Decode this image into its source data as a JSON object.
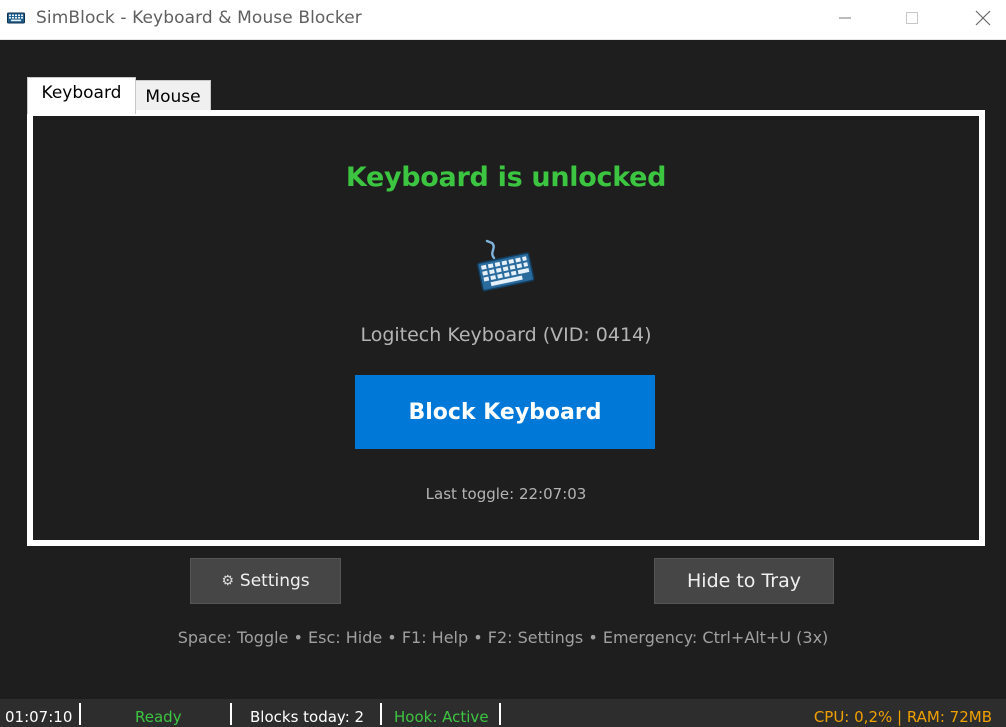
{
  "window": {
    "title": "SimBlock - Keyboard & Mouse Blocker",
    "icons": {
      "app": "keyboard-icon",
      "minimize": "minimize-icon",
      "maximize": "maximize-icon",
      "close": "close-icon"
    }
  },
  "tabs": [
    {
      "label": "Keyboard",
      "active": true
    },
    {
      "label": "Mouse",
      "active": false
    }
  ],
  "panel": {
    "status_text": "Keyboard is unlocked",
    "status_color": "#3cc540",
    "device_icon": "keyboard-icon",
    "device_label": "Logitech Keyboard (VID: 0414)",
    "action_button": "Block Keyboard",
    "action_color": "#0078d7",
    "last_toggle": "Last toggle: 22:07:03"
  },
  "buttons": {
    "settings_icon": "⚙",
    "settings_label": "Settings",
    "hide_tray_label": "Hide to Tray"
  },
  "shortcuts_hint": "Space: Toggle • Esc: Hide • F1: Help • F2: Settings • Emergency: Ctrl+Alt+U (3x)",
  "statusbar": {
    "time": "01:07:10",
    "state": "Ready",
    "blocks_today": "Blocks today: 2",
    "hook": "Hook: Active",
    "resources": "CPU: 0,2% | RAM: 72MB"
  }
}
